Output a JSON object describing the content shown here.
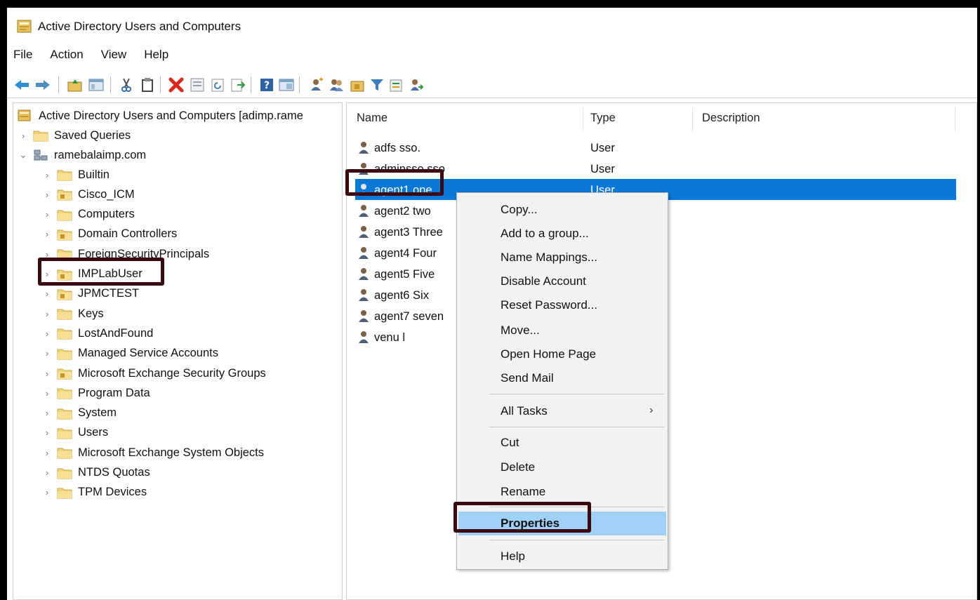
{
  "window": {
    "title": "Active Directory Users and Computers"
  },
  "menubar": [
    "File",
    "Action",
    "View",
    "Help"
  ],
  "toolbar": {
    "buttons": [
      "back-icon",
      "forward-icon",
      "up-folder-icon",
      "console-tree-icon",
      "cut-icon",
      "copy-icon",
      "delete-icon",
      "properties-icon",
      "refresh-icon",
      "export-icon",
      "help-icon",
      "view-icon",
      "new-user-icon",
      "new-group-icon",
      "new-ou-icon",
      "filter-icon",
      "add-to-group-icon",
      "delegate-icon"
    ]
  },
  "tree": {
    "root": "Active Directory Users and Computers [adimp.rame",
    "saved_queries": "Saved Queries",
    "domain": "ramebalaimp.com",
    "items": [
      "Builtin",
      "Cisco_ICM",
      "Computers",
      "Domain Controllers",
      "ForeignSecurityPrincipals",
      "IMPLabUser",
      "JPMCTEST",
      "Keys",
      "LostAndFound",
      "Managed Service Accounts",
      "Microsoft Exchange Security Groups",
      "Program Data",
      "System",
      "Users",
      "Microsoft Exchange System Objects",
      "NTDS Quotas",
      "TPM Devices"
    ]
  },
  "list": {
    "columns": {
      "name": "Name",
      "type": "Type",
      "description": "Description"
    },
    "rows": [
      {
        "name": "adfs sso.",
        "type": "User"
      },
      {
        "name": "adminsso sso",
        "type": "User"
      },
      {
        "name": "agent1 one",
        "type": "User"
      },
      {
        "name": "agent2 two",
        "type": ""
      },
      {
        "name": "agent3 Three",
        "type": ""
      },
      {
        "name": "agent4 Four",
        "type": ""
      },
      {
        "name": "agent5 Five",
        "type": ""
      },
      {
        "name": "agent6 Six",
        "type": ""
      },
      {
        "name": "agent7 seven",
        "type": ""
      },
      {
        "name": "venu l",
        "type": ""
      }
    ]
  },
  "context_menu": {
    "items": [
      "Copy...",
      "Add to a group...",
      "Name Mappings...",
      "Disable Account",
      "Reset Password...",
      "Move...",
      "Open Home Page",
      "Send Mail",
      "All Tasks",
      "Cut",
      "Delete",
      "Rename",
      "Properties",
      "Help"
    ],
    "submenu_arrow": "›"
  },
  "colors": {
    "selection": "#0a78d7",
    "menu_highlight": "#9fd0f5",
    "callout": "#3a0a10"
  }
}
